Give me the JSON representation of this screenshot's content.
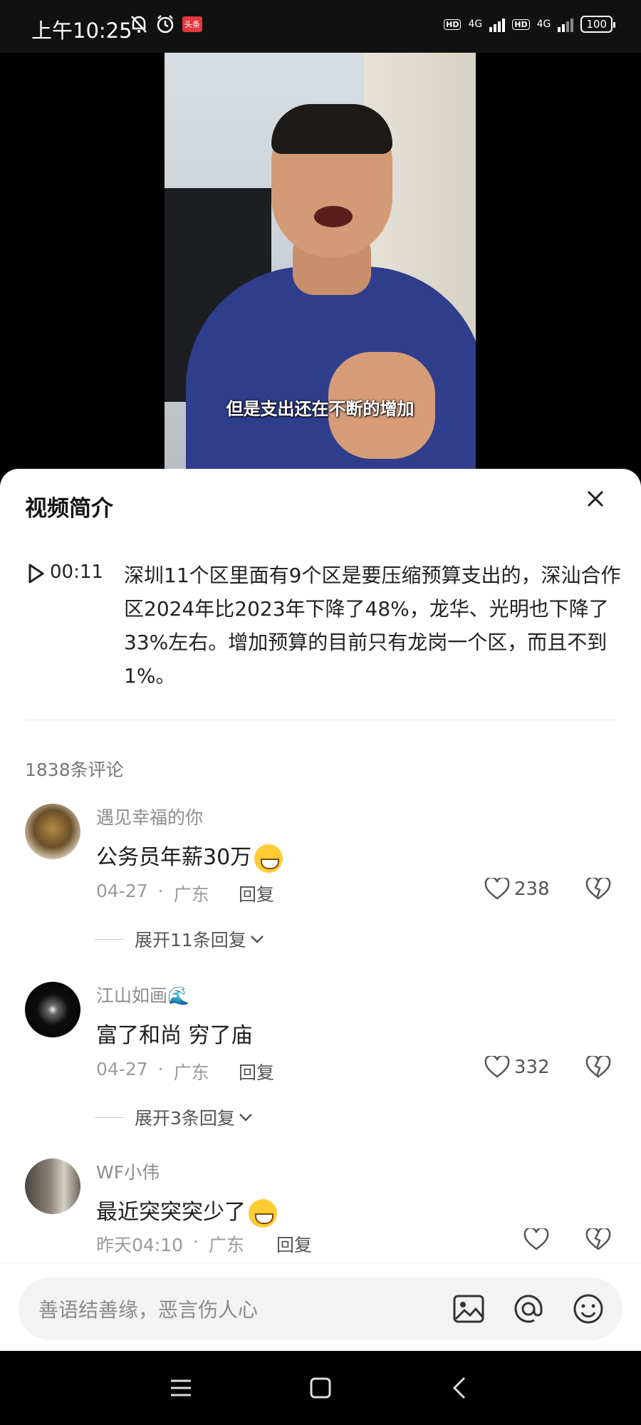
{
  "status_bar": {
    "time": "上午10:25",
    "badge": "头条",
    "network1": "4G",
    "network2": "4G",
    "hd": "HD",
    "battery": "100"
  },
  "video": {
    "subtitle": "但是支出还在不断的增加"
  },
  "sheet": {
    "title": "视频简介",
    "chapter_time": "00:11",
    "chapter_text": "深圳11个区里面有9个区是要压缩预算支出的，深汕合作区2024年比2023年下降了48%，龙华、光明也下降了33%左右。增加预算的目前只有龙岗一个区，而且不到1%。",
    "comment_count": "1838条评论"
  },
  "comments": [
    {
      "user": "遇见幸福的你",
      "text": "公务员年薪30万",
      "date": "04-27",
      "location": "广东",
      "reply": "回复",
      "likes": "238",
      "expand": "展开11条回复"
    },
    {
      "user": "江山如画🌊",
      "text": "富了和尚 穷了庙",
      "date": "04-27",
      "location": "广东",
      "reply": "回复",
      "likes": "332",
      "expand": "展开3条回复"
    },
    {
      "user": "WF小伟",
      "text": "最近突突突少了",
      "date": "昨天04:10",
      "location": "广东",
      "reply": "回复",
      "likes": ""
    }
  ],
  "input": {
    "placeholder": "善语结善缘，恶言伤人心"
  },
  "meta_sep": "·",
  "colors": {
    "accent_like": "#555555",
    "sheet_bg": "#ffffff",
    "badge": "#e0383e"
  }
}
